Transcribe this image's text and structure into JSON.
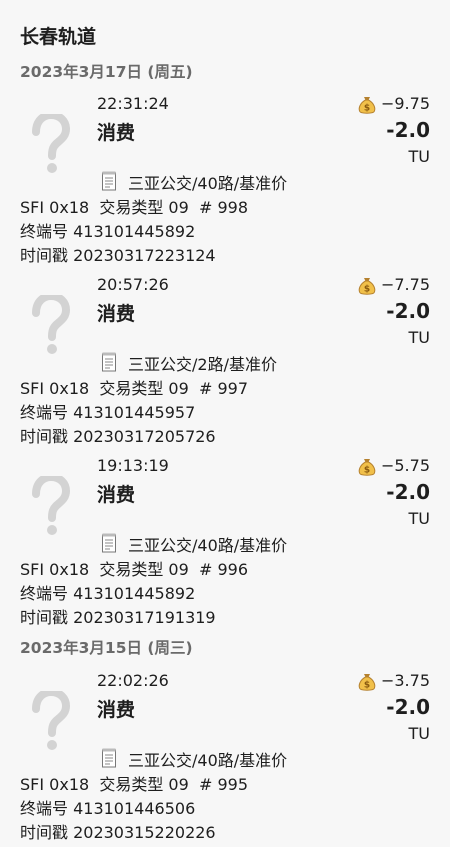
{
  "page": {
    "title": "长春轨道"
  },
  "groups": [
    {
      "date": "2023年3月17日 (周五)",
      "transactions": [
        {
          "time": "22:31:24",
          "type": "消费",
          "balance": "−9.75",
          "amount": "-2.0",
          "unit": "TU",
          "route": "三亚公交/40路/基准价",
          "sfi_line": "SFI 0x18  交易类型 09  # 998",
          "terminal_line": "终端号 413101445892",
          "timestamp_line": "时间戳 20230317223124"
        },
        {
          "time": "20:57:26",
          "type": "消费",
          "balance": "−7.75",
          "amount": "-2.0",
          "unit": "TU",
          "route": "三亚公交/2路/基准价",
          "sfi_line": "SFI 0x18  交易类型 09  # 997",
          "terminal_line": "终端号 413101445957",
          "timestamp_line": "时间戳 20230317205726"
        },
        {
          "time": "19:13:19",
          "type": "消费",
          "balance": "−5.75",
          "amount": "-2.0",
          "unit": "TU",
          "route": "三亚公交/40路/基准价",
          "sfi_line": "SFI 0x18  交易类型 09  # 996",
          "terminal_line": "终端号 413101445892",
          "timestamp_line": "时间戳 20230317191319"
        }
      ]
    },
    {
      "date": "2023年3月15日 (周三)",
      "transactions": [
        {
          "time": "22:02:26",
          "type": "消费",
          "balance": "−3.75",
          "amount": "-2.0",
          "unit": "TU",
          "route": "三亚公交/40路/基准价",
          "sfi_line": "SFI 0x18  交易类型 09  # 995",
          "terminal_line": "终端号 413101446506",
          "timestamp_line": "时间戳 20230315220226"
        }
      ]
    }
  ],
  "icons": {
    "unknown_transit": "question-mark-icon",
    "balance": "money-bag-icon",
    "route": "receipt-icon"
  }
}
